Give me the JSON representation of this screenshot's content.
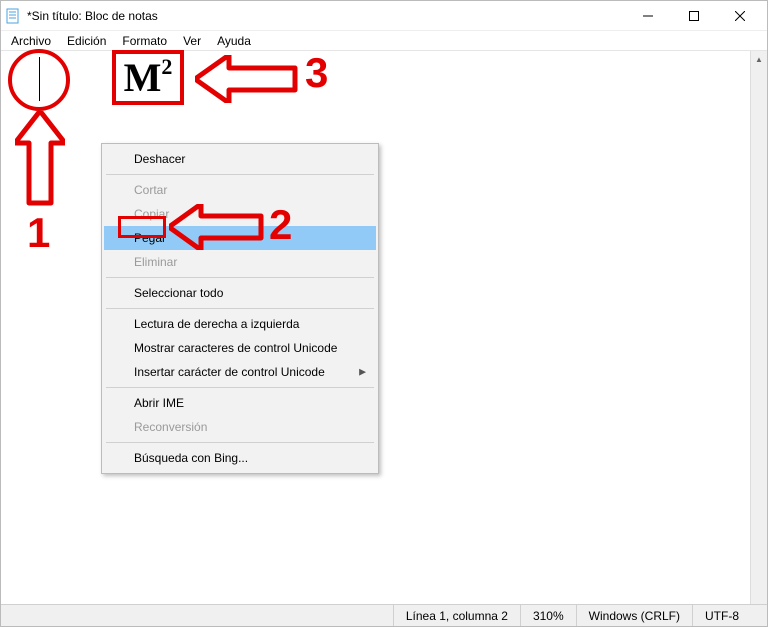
{
  "title": "*Sin título: Bloc de notas",
  "menubar": {
    "archivo": "Archivo",
    "edicion": "Edición",
    "formato": "Formato",
    "ver": "Ver",
    "ayuda": "Ayuda"
  },
  "context_menu": {
    "deshacer": "Deshacer",
    "cortar": "Cortar",
    "copiar": "Copiar",
    "pegar": "Pegar",
    "eliminar": "Eliminar",
    "seleccionar_todo": "Seleccionar todo",
    "rtl": "Lectura de derecha a izquierda",
    "mostrar_unicode": "Mostrar caracteres de control Unicode",
    "insertar_unicode": "Insertar carácter de control Unicode",
    "abrir_ime": "Abrir IME",
    "reconversion": "Reconversión",
    "bing": "Búsqueda con Bing..."
  },
  "statusbar": {
    "position": "Línea 1, columna 2",
    "zoom": "310%",
    "line_ending": "Windows (CRLF)",
    "encoding": "UTF-8"
  },
  "annotations": {
    "label1": "1",
    "label2": "2",
    "label3": "3",
    "m2_text": "M",
    "m2_sup": "2"
  }
}
